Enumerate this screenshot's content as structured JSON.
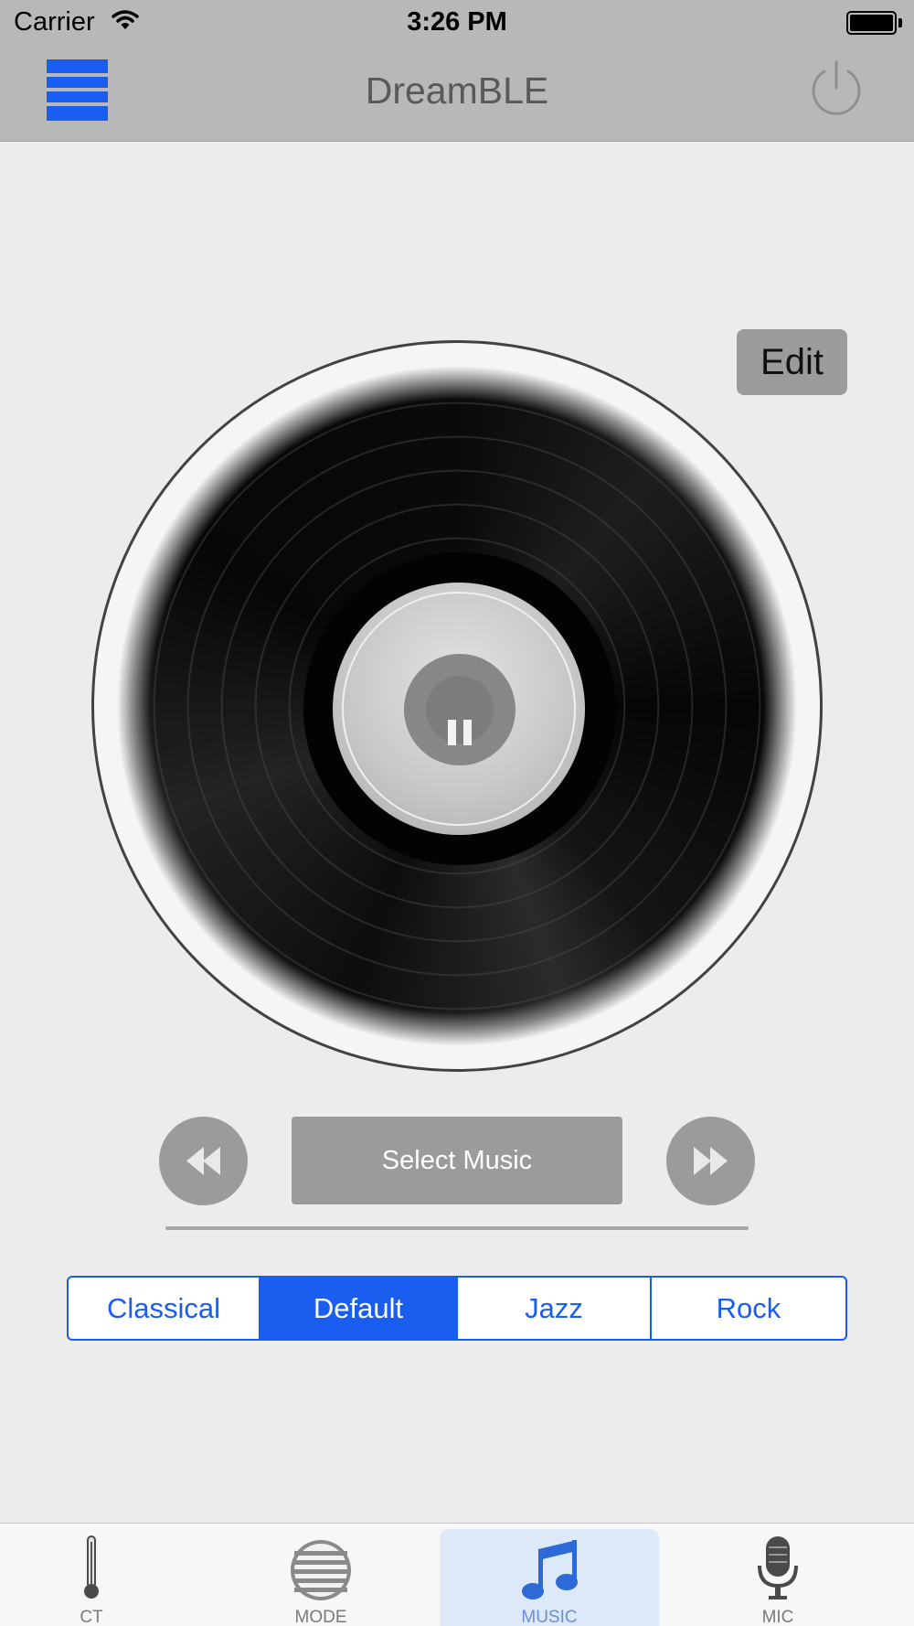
{
  "status_bar": {
    "carrier": "Carrier",
    "time": "3:26 PM",
    "battery_level": 1.0
  },
  "nav": {
    "title": "DreamBLE",
    "menu_icon": "list-icon",
    "power_icon": "power-icon"
  },
  "player": {
    "edit_label": "Edit",
    "state": "playing",
    "pause_icon": "pause-icon",
    "prev_icon": "rewind-icon",
    "next_icon": "fast-forward-icon",
    "select_music_label": "Select Music",
    "progress": 0
  },
  "equalizer": {
    "options": [
      "Classical",
      "Default",
      "Jazz",
      "Rock"
    ],
    "selected": "Default"
  },
  "tabs": [
    {
      "label": "CT",
      "icon": "thermometer-icon",
      "active": false
    },
    {
      "label": "MODE",
      "icon": "striped-circle-icon",
      "active": false
    },
    {
      "label": "MUSIC",
      "icon": "music-note-icon",
      "active": true
    },
    {
      "label": "MIC",
      "icon": "microphone-icon",
      "active": false
    }
  ],
  "colors": {
    "accent": "#1a5ef0",
    "bar_background": "#b8b8b8",
    "button_gray": "#9b9b9b",
    "page_background": "#ececed"
  }
}
